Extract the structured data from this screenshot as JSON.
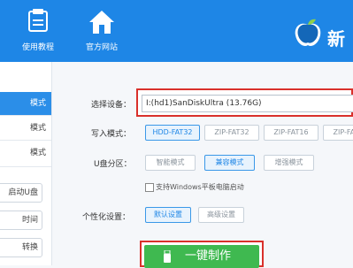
{
  "header": {
    "buttons": [
      {
        "label": "使用教程",
        "icon": "toolbox-icon"
      },
      {
        "label": "官方网站",
        "icon": "home-icon"
      }
    ],
    "brand_text": "新",
    "colors": {
      "bar": "#1e86e6",
      "accent_red": "#d9302b",
      "green": "#3fb950"
    }
  },
  "sidebar": {
    "items": [
      {
        "label": "模式",
        "active": true
      },
      {
        "label": "模式",
        "active": false
      },
      {
        "label": "模式",
        "active": false
      }
    ],
    "buttons": [
      {
        "label": "启动U盘"
      },
      {
        "label": "时间"
      },
      {
        "label": "转换"
      }
    ]
  },
  "form": {
    "device_label": "选择设备：",
    "device_value": "I:(hd1)SanDiskUltra (13.76G)",
    "write_mode_label": "写入模式：",
    "write_modes": [
      {
        "label": "HDD-FAT32",
        "selected": true
      },
      {
        "label": "ZIP-FAT32",
        "selected": false
      },
      {
        "label": "ZIP-FAT16",
        "selected": false
      },
      {
        "label": "ZIP-FAT",
        "selected": false
      }
    ],
    "partition_label": "U盘分区：",
    "partitions": [
      {
        "label": "智能模式",
        "selected": false
      },
      {
        "label": "兼容模式",
        "selected": true
      },
      {
        "label": "增强模式",
        "selected": false
      }
    ],
    "tablet_boot_label": "支持Windows平板电脑启动",
    "personal_label": "个性化设置：",
    "personal_options": [
      {
        "label": "默认设置",
        "selected": true
      },
      {
        "label": "高级设置",
        "selected": false
      }
    ],
    "make_button": "一键制作"
  }
}
